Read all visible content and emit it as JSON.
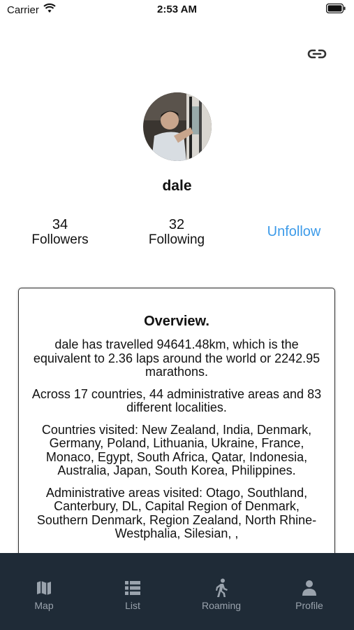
{
  "status_bar": {
    "carrier": "Carrier",
    "time": "2:53 AM"
  },
  "profile": {
    "username": "dale",
    "followers_count": "34",
    "followers_label": "Followers",
    "following_count": "32",
    "following_label": "Following",
    "unfollow_label": "Unfollow"
  },
  "overview": {
    "title": "Overview.",
    "paragraphs": [
      "dale has travelled 94641.48km, which is the equivalent to 2.36 laps around the world or 2242.95 marathons.",
      "Across 17 countries, 44 administrative areas and 83 different localities.",
      "Countries visited: New Zealand, India, Denmark, Germany, Poland, Lithuania, Ukraine, France, Monaco, Egypt, South Africa, Qatar, Indonesia, Australia, Japan, South Korea, Philippines.",
      "Administrative areas visited: Otago, Southland, Canterbury, DL, Capital Region of Denmark, Southern Denmark, Region Zealand, North Rhine-Westphalia, Silesian, ,"
    ]
  },
  "tabs": [
    {
      "label": "Map",
      "icon": "map-icon"
    },
    {
      "label": "List",
      "icon": "list-icon"
    },
    {
      "label": "Roaming",
      "icon": "walking-icon"
    },
    {
      "label": "Profile",
      "icon": "person-icon"
    }
  ],
  "colors": {
    "accent": "#3d9be9",
    "tab_bar": "#1f2b37",
    "tab_inactive": "#9aa3ad"
  }
}
